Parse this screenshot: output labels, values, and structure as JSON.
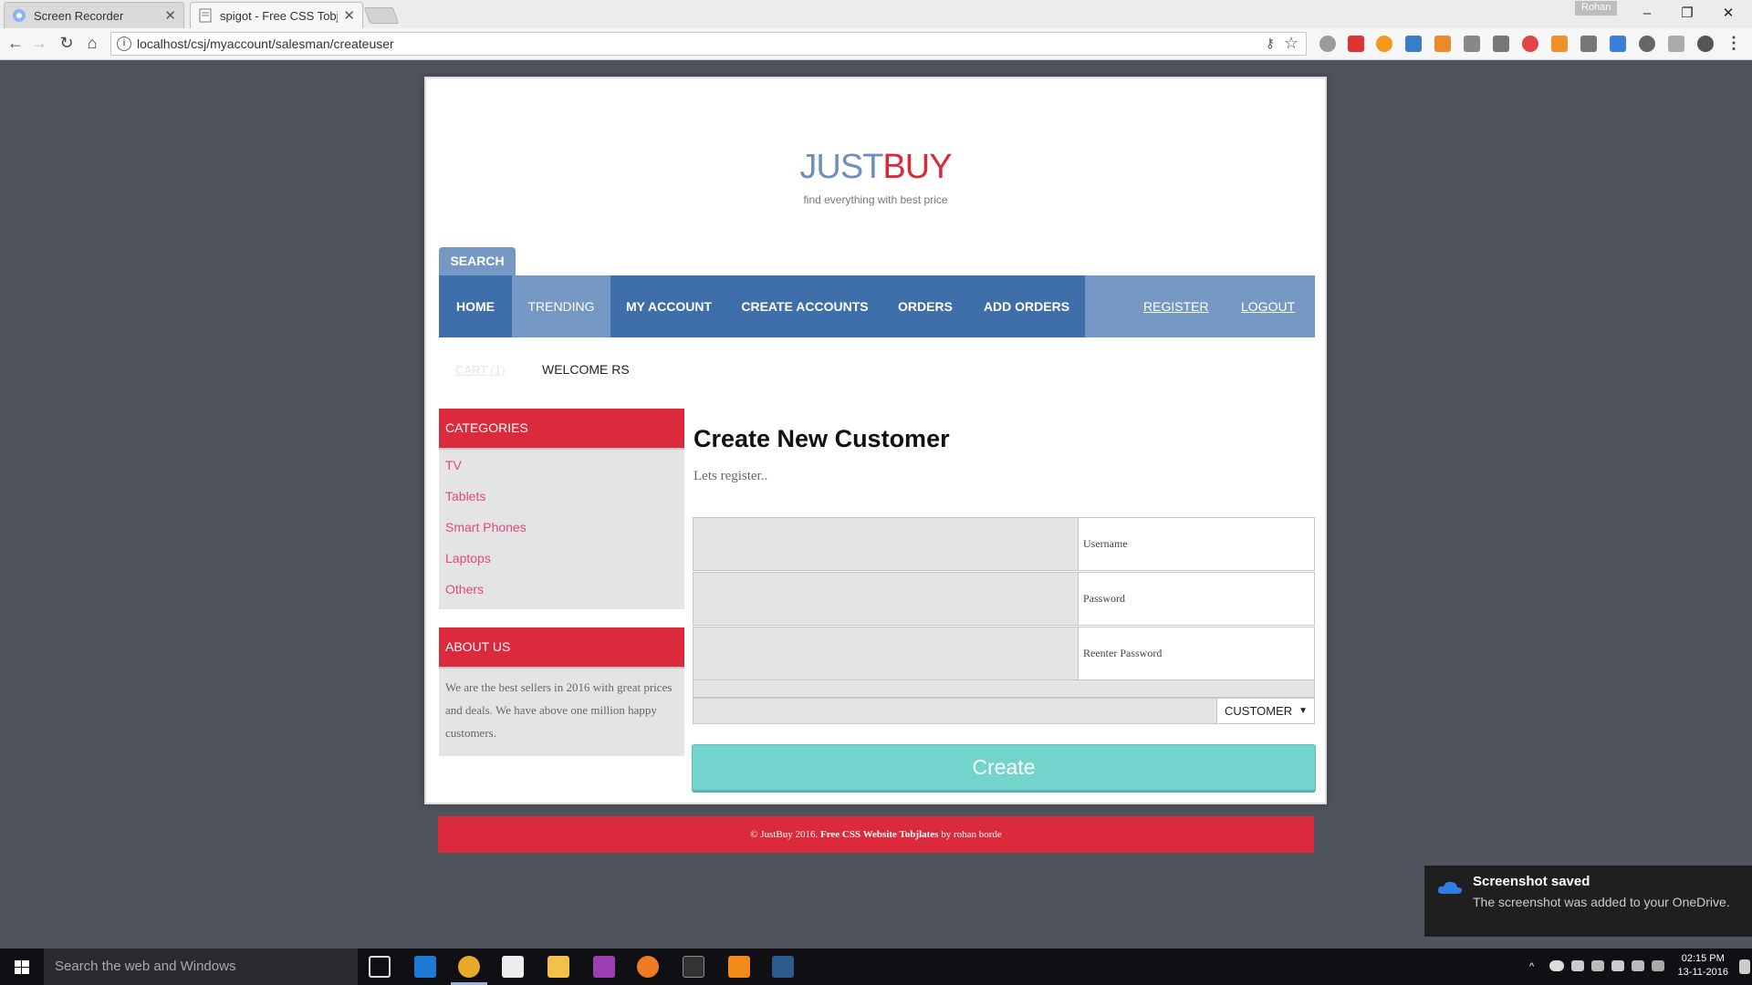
{
  "browser": {
    "tabs": [
      {
        "title": "Screen Recorder",
        "active": false
      },
      {
        "title": "spigot - Free CSS Tobjlates",
        "active": true
      }
    ],
    "profile_name": "Rohan",
    "url": "localhost/csj/myaccount/salesman/createuser"
  },
  "site": {
    "logo_part1": "JUST",
    "logo_part2": "BUY",
    "tagline": "find everything with best price",
    "search_tab": "SEARCH",
    "nav": [
      {
        "label": "HOME"
      },
      {
        "label": "TRENDING"
      },
      {
        "label": "MY ACCOUNT"
      },
      {
        "label": "CREATE ACCOUNTS"
      },
      {
        "label": "ORDERS"
      },
      {
        "label": "ADD ORDERS"
      }
    ],
    "register_link": "REGISTER",
    "logout_link": "LOGOUT",
    "cart_link": "CART (1)",
    "welcome": "WELCOME RS"
  },
  "sidebar": {
    "categories_title": "CATEGORIES",
    "categories": [
      "TV",
      "Tablets",
      "Smart Phones",
      "Laptops",
      "Others"
    ],
    "about_title": "ABOUT US",
    "about_text": "We are the best sellers in 2016 with great prices and deals. We have above one million happy customers."
  },
  "form": {
    "title": "Create New Customer",
    "subtitle": "Lets register..",
    "username_placeholder": "Username",
    "password_placeholder": "Password",
    "reenter_placeholder": "Reenter Password",
    "role_selected": "CUSTOMER",
    "create_button": "Create"
  },
  "footer": {
    "copyright": "© JustBuy 2016.",
    "link_text": "Free CSS Website Tobjlates",
    "by_text": "by rohan borde"
  },
  "notification": {
    "title": "Screenshot saved",
    "body": "The screenshot was added to your OneDrive."
  },
  "taskbar": {
    "search_placeholder": "Search the web and Windows",
    "time": "02:15 PM",
    "date": "13-11-2016"
  },
  "colors": {
    "brand_blue": "#3f6faa",
    "nav_light": "#7698c5",
    "brand_red": "#db2a3b",
    "create_teal": "#72d4cb",
    "category_link": "#e1487a"
  }
}
